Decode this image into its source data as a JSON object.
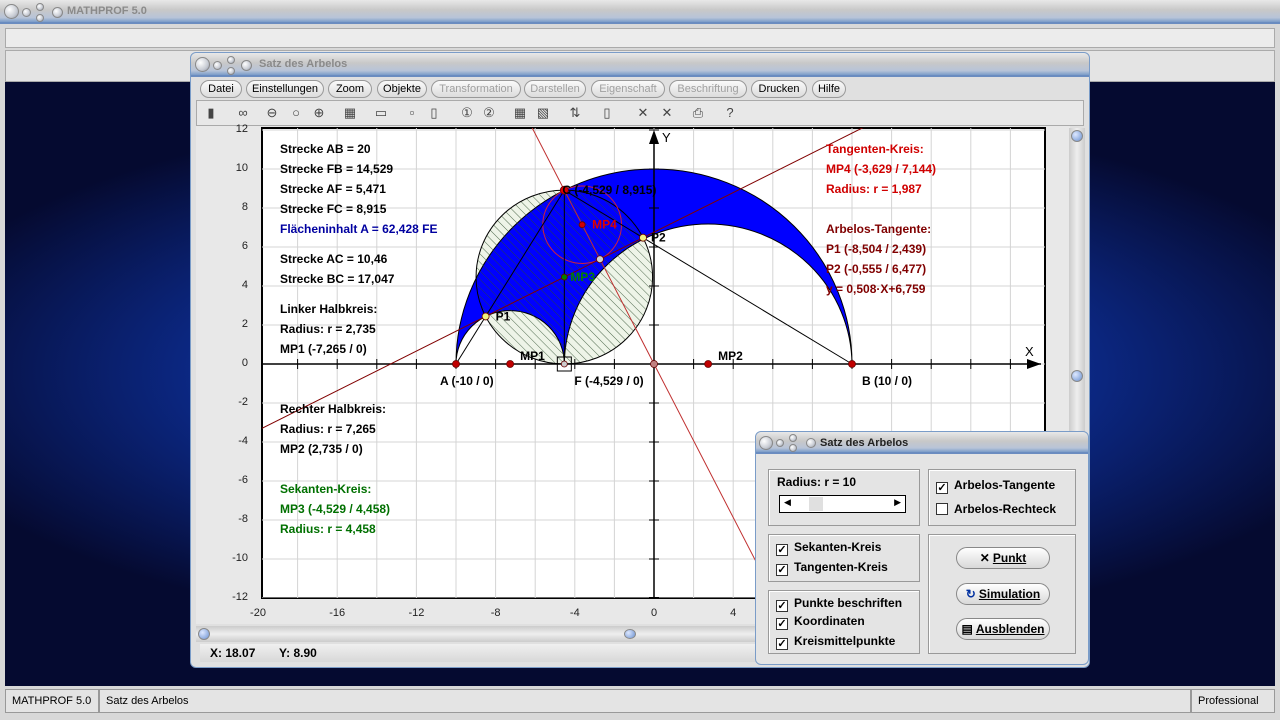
{
  "app": {
    "title": "MATHPROF 5.0"
  },
  "window": {
    "title": "Satz des Arbelos"
  },
  "menu": [
    {
      "label": "Datei",
      "enabled": true
    },
    {
      "label": "Einstellungen",
      "enabled": true
    },
    {
      "label": "Zoom",
      "enabled": true
    },
    {
      "label": "Objekte",
      "enabled": true
    },
    {
      "label": "Transformation",
      "enabled": false
    },
    {
      "label": "Darstellen",
      "enabled": false
    },
    {
      "label": "Eigenschaft",
      "enabled": false
    },
    {
      "label": "Beschriftung",
      "enabled": false
    },
    {
      "label": "Drucken",
      "enabled": true
    },
    {
      "label": "Hilfe",
      "enabled": true
    }
  ],
  "toolbar": [
    "panel-icon",
    "glasses-icon",
    "zoom-out-icon",
    "zoom-reset-icon",
    "zoom-in-icon",
    "properties-icon",
    "window-icon",
    "single-view-icon",
    "dual-view-icon",
    "circle-1-icon",
    "circle-2-icon",
    "table-icon",
    "chart-icon",
    "export-icon",
    "copy-icon",
    "cross-icon",
    "cross-double-icon",
    "print-icon",
    "help-icon"
  ],
  "plot": {
    "x_ticks": [
      "-20",
      "-16",
      "-12",
      "-8",
      "-4",
      "0",
      "4"
    ],
    "y_ticks": [
      "12",
      "10",
      "8",
      "6",
      "4",
      "2",
      "0",
      "-2",
      "-4",
      "-6",
      "-8",
      "-10",
      "-12"
    ],
    "axis_x": "X",
    "axis_y": "Y",
    "colors": {
      "arbelos": "#0000ff",
      "secant": "#007000",
      "tangent_circle": "#d00000",
      "tangent_line": "#800000"
    },
    "points": {
      "A": "A (-10 / 0)",
      "F": "F (-4,529 / 0)",
      "B": "B (10 / 0)",
      "C": "C (-4,529 / 8,915)",
      "MP1": "MP1",
      "MP2": "MP2",
      "MP3": "MP3",
      "MP4": "MP4",
      "P1": "P1",
      "P2": "P2"
    },
    "left_info": [
      {
        "t": "Strecke AB = 20",
        "c": "#000"
      },
      {
        "t": "Strecke FB = 14,529",
        "c": "#000"
      },
      {
        "t": "Strecke AF = 5,471",
        "c": "#000"
      },
      {
        "t": "Strecke FC = 8,915",
        "c": "#000"
      },
      {
        "t": "Flächeninhalt A = 62,428 FE",
        "c": "#0000a0"
      },
      {
        "t": "Strecke AC = 10,46",
        "c": "#000"
      },
      {
        "t": "Strecke BC = 17,047",
        "c": "#000"
      },
      {
        "t": "Linker Halbkreis:",
        "c": "#000"
      },
      {
        "t": "Radius: r = 2,735",
        "c": "#000"
      },
      {
        "t": "MP1 (-7,265 / 0)",
        "c": "#000"
      },
      {
        "t": "Rechter Halbkreis:",
        "c": "#000"
      },
      {
        "t": "Radius: r = 7,265",
        "c": "#000"
      },
      {
        "t": "MP2 (2,735 / 0)",
        "c": "#000"
      },
      {
        "t": "Sekanten-Kreis:",
        "c": "#007000"
      },
      {
        "t": "MP3 (-4,529 / 4,458)",
        "c": "#007000"
      },
      {
        "t": "Radius: r = 4,458",
        "c": "#007000"
      }
    ],
    "right_info": [
      {
        "t": "Tangenten-Kreis:",
        "c": "#d00000"
      },
      {
        "t": "MP4 (-3,629 / 7,144)",
        "c": "#d00000"
      },
      {
        "t": "Radius: r = 1,987",
        "c": "#d00000"
      },
      {
        "t": "Arbelos-Tangente:",
        "c": "#800000"
      },
      {
        "t": "P1 (-8,504 / 2,439)",
        "c": "#800000"
      },
      {
        "t": "P2 (-0,555 / 6,477)",
        "c": "#800000"
      },
      {
        "t": "y = 0,508·X+6,759",
        "c": "#800000"
      }
    ]
  },
  "coords": {
    "x": "X: 18.07",
    "y": "Y: 8.90"
  },
  "dialog": {
    "title": "Satz des Arbelos",
    "radius_label": "Radius:  r = 10",
    "radius_value": 10,
    "checks": [
      {
        "label": "Arbelos-Tangente",
        "checked": true
      },
      {
        "label": "Arbelos-Rechteck",
        "checked": false
      },
      {
        "label": "Sekanten-Kreis",
        "checked": true
      },
      {
        "label": "Tangenten-Kreis",
        "checked": true
      },
      {
        "label": "Punkte beschriften",
        "checked": true
      },
      {
        "label": "Koordinaten",
        "checked": true
      },
      {
        "label": "Kreismittelpunkte",
        "checked": true
      }
    ],
    "buttons": {
      "punkt": "Punkt",
      "simulation": "Simulation",
      "ausblenden": "Ausblenden"
    }
  },
  "status": {
    "app": "MATHPROF 5.0",
    "doc": "Satz des Arbelos",
    "edition": "Professional"
  }
}
